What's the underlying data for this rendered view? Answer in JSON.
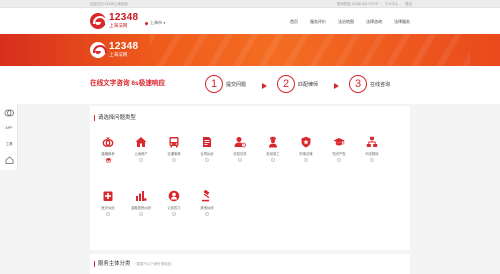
{
  "topbar": {
    "welcome": "欢迎访问 12348上海法网",
    "right_links": [
      "咨询热线 12348 021 47279",
      "个人中心",
      "退出"
    ]
  },
  "header": {
    "logo_number": "12348",
    "logo_name": "上海法网",
    "city": "上海市",
    "nav": [
      "首页",
      "服务评价",
      "法治地图",
      "法律咨询",
      "法律服务"
    ]
  },
  "banner": {
    "logo_number": "12348",
    "logo_name": "上海法网"
  },
  "steps": {
    "headline": "在线文字咨询 6s极速响应",
    "items": [
      {
        "num": "1",
        "label": "提交问题"
      },
      {
        "num": "2",
        "label": "匹配律师"
      },
      {
        "num": "3",
        "label": "在线咨询"
      }
    ]
  },
  "sidebar": {
    "items": [
      "APP",
      "工具"
    ]
  },
  "problem_types": {
    "title": "请选择问题类型",
    "categories": [
      {
        "label": "婚姻继承",
        "icon": "rings-icon",
        "selected": true
      },
      {
        "label": "土地房产",
        "icon": "house-icon",
        "selected": false
      },
      {
        "label": "交通事故",
        "icon": "bus-icon",
        "selected": false
      },
      {
        "label": "合同纠纷",
        "icon": "contract-icon",
        "selected": false
      },
      {
        "label": "债权债务",
        "icon": "debt-icon",
        "selected": false
      },
      {
        "label": "劳动用工",
        "icon": "worker-icon",
        "selected": false
      },
      {
        "label": "刑事法律",
        "icon": "shield-icon",
        "selected": false
      },
      {
        "label": "知识产权",
        "icon": "graduation-cap-icon",
        "selected": false
      },
      {
        "label": "司法程序",
        "icon": "hierarchy-icon",
        "selected": false
      },
      {
        "label": "医疗纠纷",
        "icon": "medical-icon",
        "selected": false
      },
      {
        "label": "金融投资纠纷",
        "icon": "chart-bars-icon",
        "selected": false
      },
      {
        "label": "公民权力",
        "icon": "person-circle-icon",
        "selected": false
      },
      {
        "label": "其他纠纷",
        "icon": "gavel-icon",
        "selected": false
      }
    ]
  },
  "service_section": {
    "title": "服务主体分类",
    "hint": "（若属于以下身份请勾选）"
  },
  "colors": {
    "brand_red": "#d9272e",
    "banner_orange": "#f46d22"
  }
}
